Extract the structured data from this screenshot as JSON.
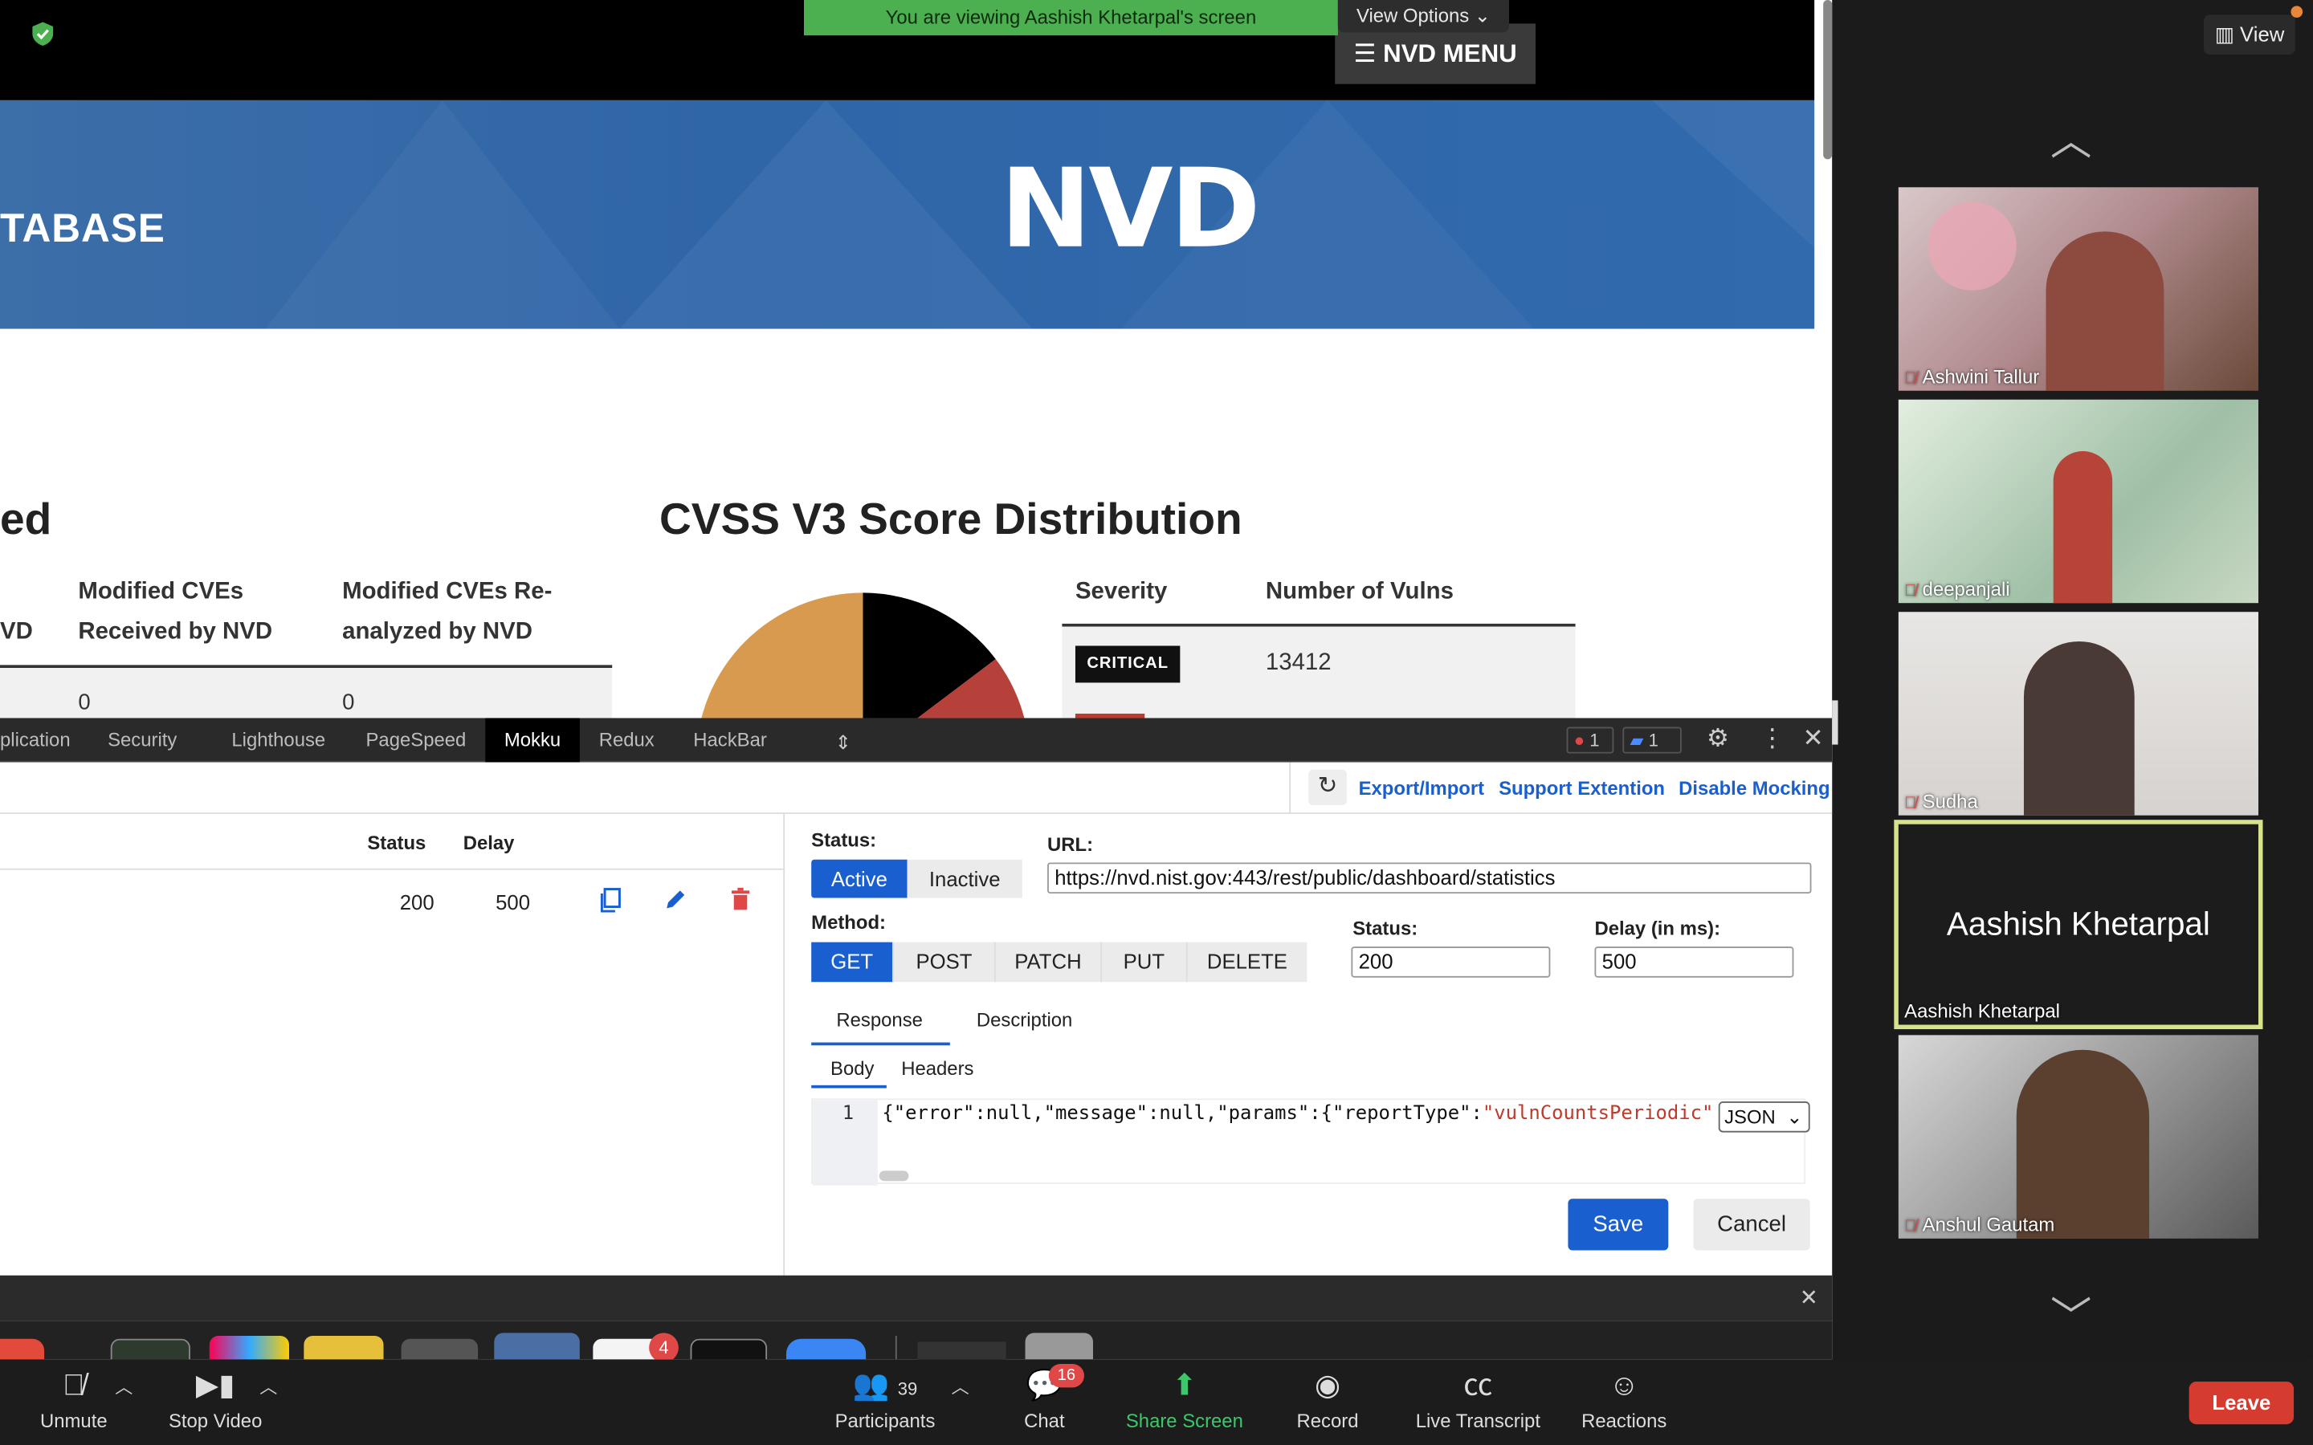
{
  "banner": {
    "viewing_text": "You are viewing Aashish Khetarpal's screen",
    "view_options": "View Options ⌄"
  },
  "nvd": {
    "menu_label": "☰ NVD MENU",
    "banner_left_text": "TABASE",
    "logo_text": "NVD",
    "left_heading": "ed",
    "left_table": {
      "col0_header": "VD",
      "col1_header_line1": "Modified CVEs",
      "col1_header_line2": "Received by NVD",
      "col2_header_line1": "Modified CVEs Re-",
      "col2_header_line2": "analyzed by NVD",
      "col1_value": "0",
      "col2_value": "0"
    },
    "cvss_title": "CVSS V3 Score Distribution",
    "severity_table": {
      "col_severity": "Severity",
      "col_vulns": "Number of Vulns",
      "rows": [
        {
          "severity": "CRITICAL",
          "count": "13412"
        }
      ]
    },
    "pie_colors": {
      "orange": "#d89a4e",
      "black": "#000000",
      "red": "#b6413a"
    }
  },
  "devtools": {
    "tabs": [
      "plication",
      "Security",
      "Lighthouse",
      "PageSpeed",
      "Mokku",
      "Redux",
      "HackBar"
    ],
    "active_tab": "Mokku",
    "error_count": "1",
    "message_count": "1",
    "toolbar_links": {
      "export": "Export/Import",
      "support": "Support Extention",
      "disable": "Disable Mocking"
    },
    "list": {
      "col_status": "Status",
      "col_delay": "Delay",
      "row": {
        "status": "200",
        "delay": "500"
      }
    },
    "editor": {
      "status_label": "Status:",
      "active_label": "Active",
      "inactive_label": "Inactive",
      "url_label": "URL:",
      "url_value": "https://nvd.nist.gov:443/rest/public/dashboard/statistics",
      "method_label": "Method:",
      "methods": [
        "GET",
        "POST",
        "PATCH",
        "PUT",
        "DELETE"
      ],
      "selected_method": "GET",
      "status_field_label": "Status:",
      "status_value": "200",
      "delay_label": "Delay (in ms):",
      "delay_value": "500",
      "tab_response": "Response",
      "tab_description": "Description",
      "sub_body": "Body",
      "sub_headers": "Headers",
      "line_number": "1",
      "code_prefix": "{\"error\":null,\"message\":null,\"params\":{\"reportType\":",
      "code_string": "\"vulnCountsPeriodic\"",
      "format": "JSON",
      "save_label": "Save",
      "cancel_label": "Cancel"
    }
  },
  "dock": {
    "notification_badge": "4"
  },
  "participants_panel": {
    "view_label": "View",
    "tiles": [
      {
        "name": "Ashwini Tallur",
        "muted": true
      },
      {
        "name": "deepanjali",
        "muted": true
      },
      {
        "name": "Sudha",
        "muted": true
      },
      {
        "name": "Aashish Khetarpal",
        "muted": false,
        "big_name": "Aashish Khetarpal"
      },
      {
        "name": "Anshul Gautam",
        "muted": true
      }
    ]
  },
  "zoom_bar": {
    "unmute": "Unmute",
    "stop_video": "Stop Video",
    "participants": "Participants",
    "participants_count": "39",
    "chat": "Chat",
    "chat_badge": "16",
    "share_screen": "Share Screen",
    "record": "Record",
    "live_transcript": "Live Transcript",
    "reactions": "Reactions",
    "leave": "Leave"
  }
}
